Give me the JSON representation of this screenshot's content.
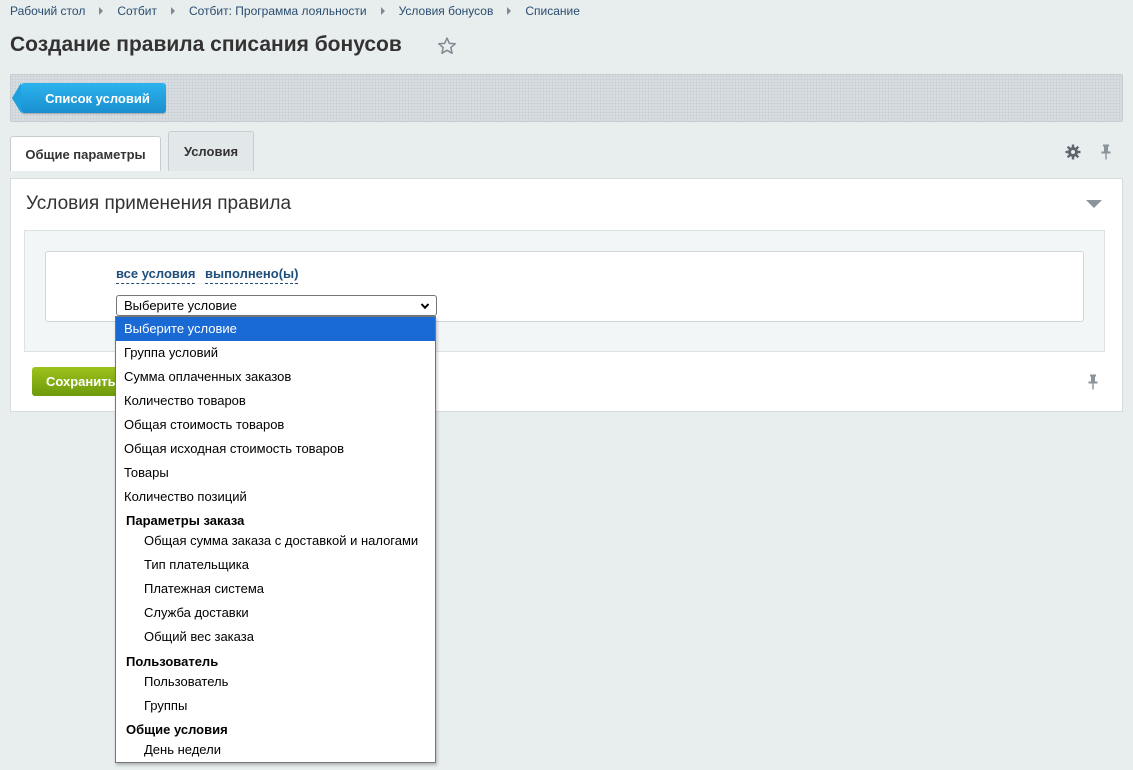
{
  "breadcrumb": [
    "Рабочий стол",
    "Сотбит",
    "Сотбит: Программа лояльности",
    "Условия бонусов",
    "Списание"
  ],
  "page_title": "Создание правила списания бонусов",
  "toolbar": {
    "list_button": "Список условий"
  },
  "tabs": [
    {
      "label": "Общие параметры",
      "active": true
    },
    {
      "label": "Условия",
      "active": false
    }
  ],
  "section": {
    "title": "Условия применения правила",
    "link_all": "все условия",
    "link_done": "выполнено(ы)",
    "select_value": "Выберите условие"
  },
  "save_button": "Сохранить",
  "dropdown": {
    "options": [
      {
        "label": "Выберите условие",
        "kind": "selected"
      },
      {
        "label": "Группа условий",
        "kind": "item"
      },
      {
        "label": "Сумма оплаченных заказов",
        "kind": "item"
      },
      {
        "label": "Количество товаров",
        "kind": "item"
      },
      {
        "label": "Общая стоимость товаров",
        "kind": "item"
      },
      {
        "label": "Общая исходная стоимость товаров",
        "kind": "item"
      },
      {
        "label": "Товары",
        "kind": "item"
      },
      {
        "label": "Количество позиций",
        "kind": "item"
      },
      {
        "label": "Параметры заказа",
        "kind": "group"
      },
      {
        "label": "Общая сумма заказа с доставкой и налогами",
        "kind": "child"
      },
      {
        "label": "Тип плательщика",
        "kind": "child"
      },
      {
        "label": "Платежная система",
        "kind": "child"
      },
      {
        "label": "Служба доставки",
        "kind": "child"
      },
      {
        "label": "Общий вес заказа",
        "kind": "child"
      },
      {
        "label": "Пользователь",
        "kind": "group"
      },
      {
        "label": "Пользователь",
        "kind": "child"
      },
      {
        "label": "Группы",
        "kind": "child"
      },
      {
        "label": "Общие условия",
        "kind": "group"
      },
      {
        "label": "День недели",
        "kind": "child"
      }
    ]
  }
}
